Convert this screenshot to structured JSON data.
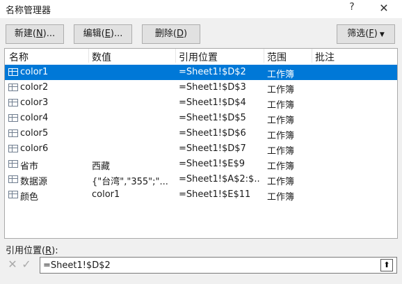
{
  "window": {
    "title": "名称管理器",
    "help": "?",
    "close": "✕"
  },
  "toolbar": {
    "new_label": "新建",
    "new_key": "N",
    "edit_label": "编辑",
    "edit_key": "E",
    "delete_label": "删除",
    "delete_key": "D",
    "filter_label": "筛选",
    "filter_key": "F"
  },
  "list": {
    "columns": [
      "名称",
      "数值",
      "引用位置",
      "范围",
      "批注"
    ],
    "rows": [
      {
        "name": "color1",
        "value": "",
        "ref": "=Sheet1!$D$2",
        "scope": "工作簿",
        "note": "",
        "selected": true
      },
      {
        "name": "color2",
        "value": "",
        "ref": "=Sheet1!$D$3",
        "scope": "工作簿",
        "note": ""
      },
      {
        "name": "color3",
        "value": "",
        "ref": "=Sheet1!$D$4",
        "scope": "工作簿",
        "note": ""
      },
      {
        "name": "color4",
        "value": "",
        "ref": "=Sheet1!$D$5",
        "scope": "工作簿",
        "note": ""
      },
      {
        "name": "color5",
        "value": "",
        "ref": "=Sheet1!$D$6",
        "scope": "工作簿",
        "note": ""
      },
      {
        "name": "color6",
        "value": "",
        "ref": "=Sheet1!$D$7",
        "scope": "工作簿",
        "note": ""
      },
      {
        "name": "省市",
        "value": "西藏",
        "ref": "=Sheet1!$E$9",
        "scope": "工作簿",
        "note": ""
      },
      {
        "name": "数据源",
        "value": "{\"台湾\",\"355\";\"...",
        "ref": "=Sheet1!$A$2:$...",
        "scope": "工作簿",
        "note": ""
      },
      {
        "name": "颜色",
        "value": "color1",
        "ref": "=Sheet1!$E$11",
        "scope": "工作簿",
        "note": ""
      }
    ]
  },
  "reference": {
    "label": "引用位置",
    "key": "R",
    "value": "=Sheet1!$D$2",
    "cancel": "✕",
    "confirm": "✓",
    "collapse": "⬆"
  },
  "colors": {
    "selection": "#0078d7",
    "background": "#f0f0f0"
  }
}
